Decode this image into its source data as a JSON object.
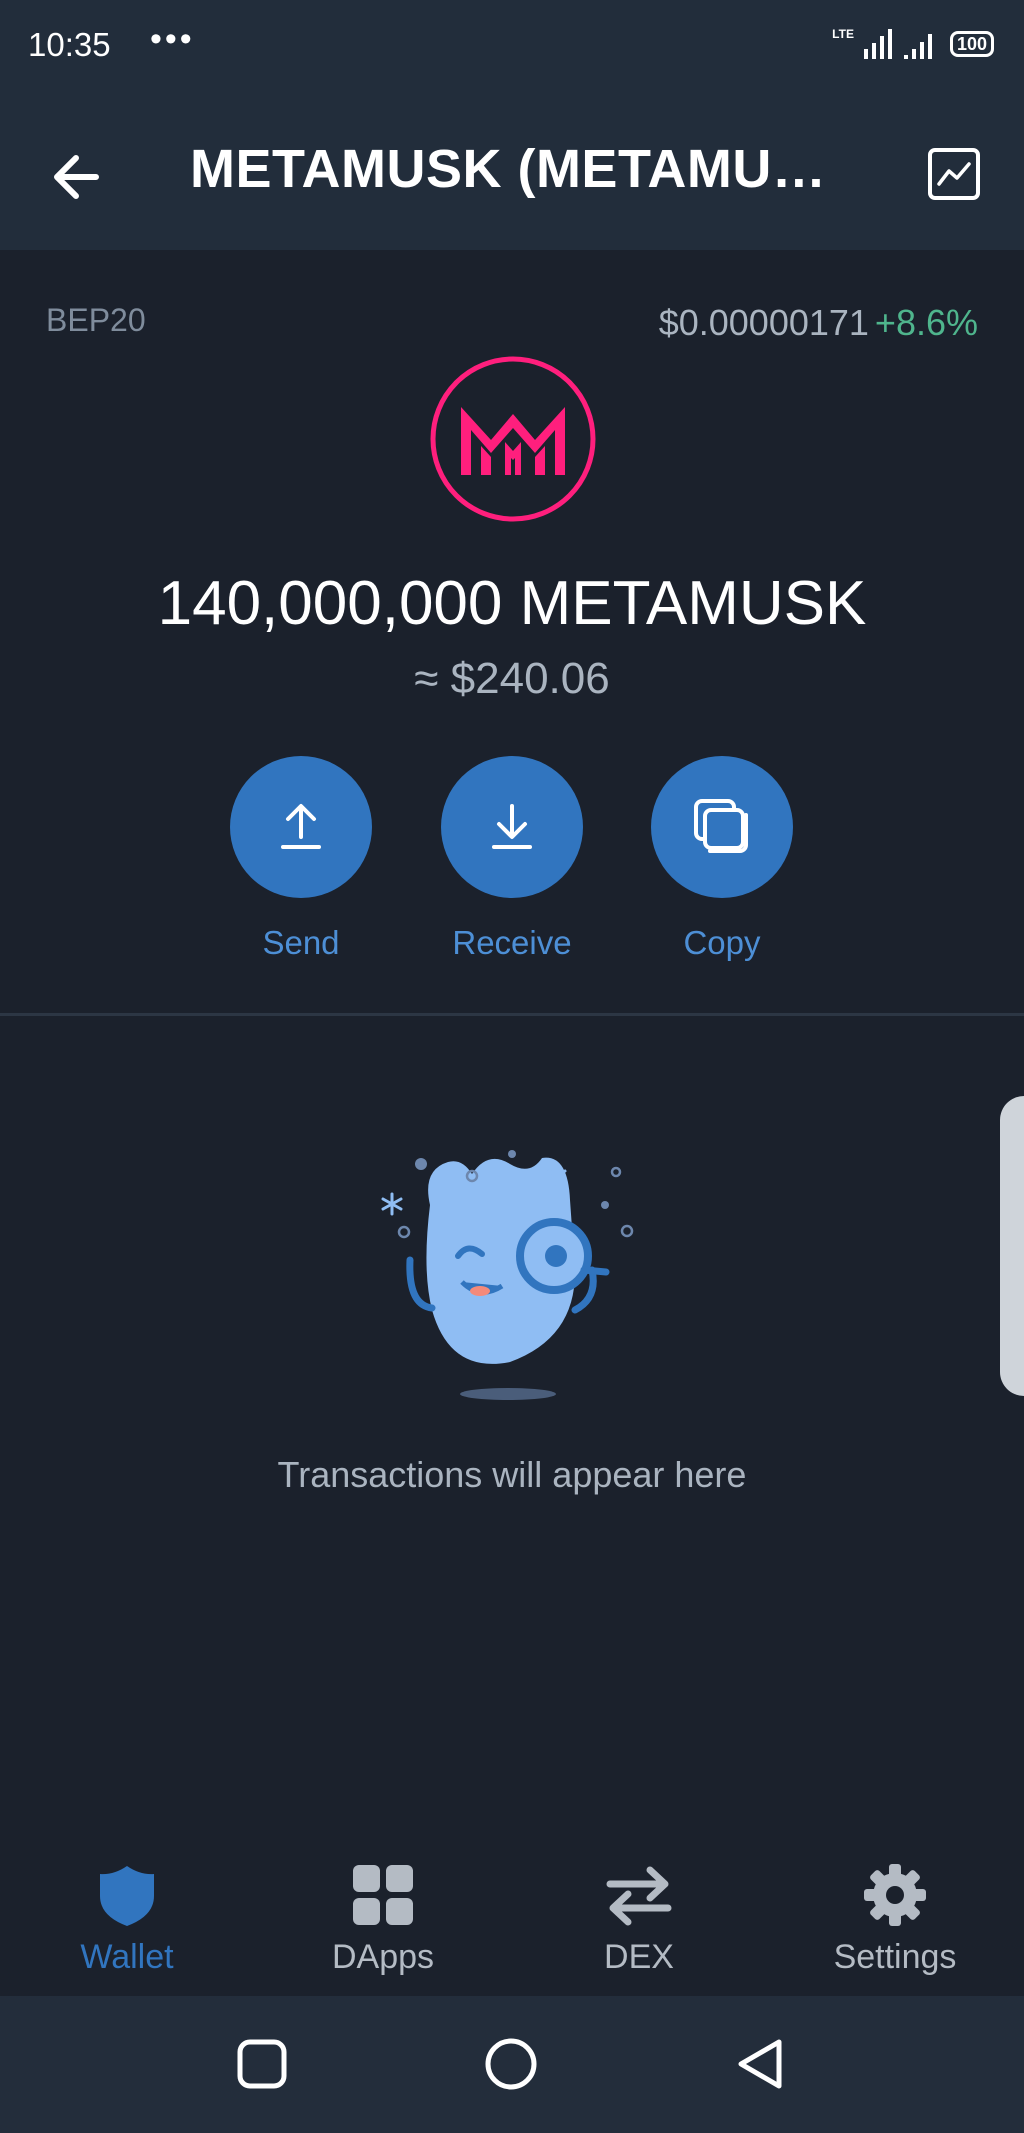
{
  "status_bar": {
    "time": "10:35",
    "dots": "•••",
    "network": "LTE",
    "battery": "100"
  },
  "header": {
    "title": "METAMUSK (METAMUSK)",
    "back_icon": "arrow-left-icon",
    "chart_icon": "line-chart-icon"
  },
  "token": {
    "network": "BEP20",
    "price": "$0.00000171",
    "change": "+8.6%",
    "balance": "140,000,000 METAMUSK",
    "fiat_value": "≈ $240.06",
    "logo_color": "#ff1f7d"
  },
  "actions": [
    {
      "label": "Send",
      "icon": "upload-arrow-icon"
    },
    {
      "label": "Receive",
      "icon": "download-arrow-icon"
    },
    {
      "label": "Copy",
      "icon": "copy-icon"
    }
  ],
  "empty_state": {
    "text": "Transactions will appear here"
  },
  "tabs": [
    {
      "label": "Wallet",
      "icon": "shield-icon",
      "active": true
    },
    {
      "label": "DApps",
      "icon": "grid-icon",
      "active": false
    },
    {
      "label": "DEX",
      "icon": "swap-arrows-icon",
      "active": false
    },
    {
      "label": "Settings",
      "icon": "gear-icon",
      "active": false
    }
  ],
  "colors": {
    "background": "#1b212c",
    "header": "#222d3b",
    "accent": "#3175bf",
    "accent_text": "#4d8fd6",
    "positive": "#4fb58d",
    "inactive_tab": "#b4bbc4"
  }
}
